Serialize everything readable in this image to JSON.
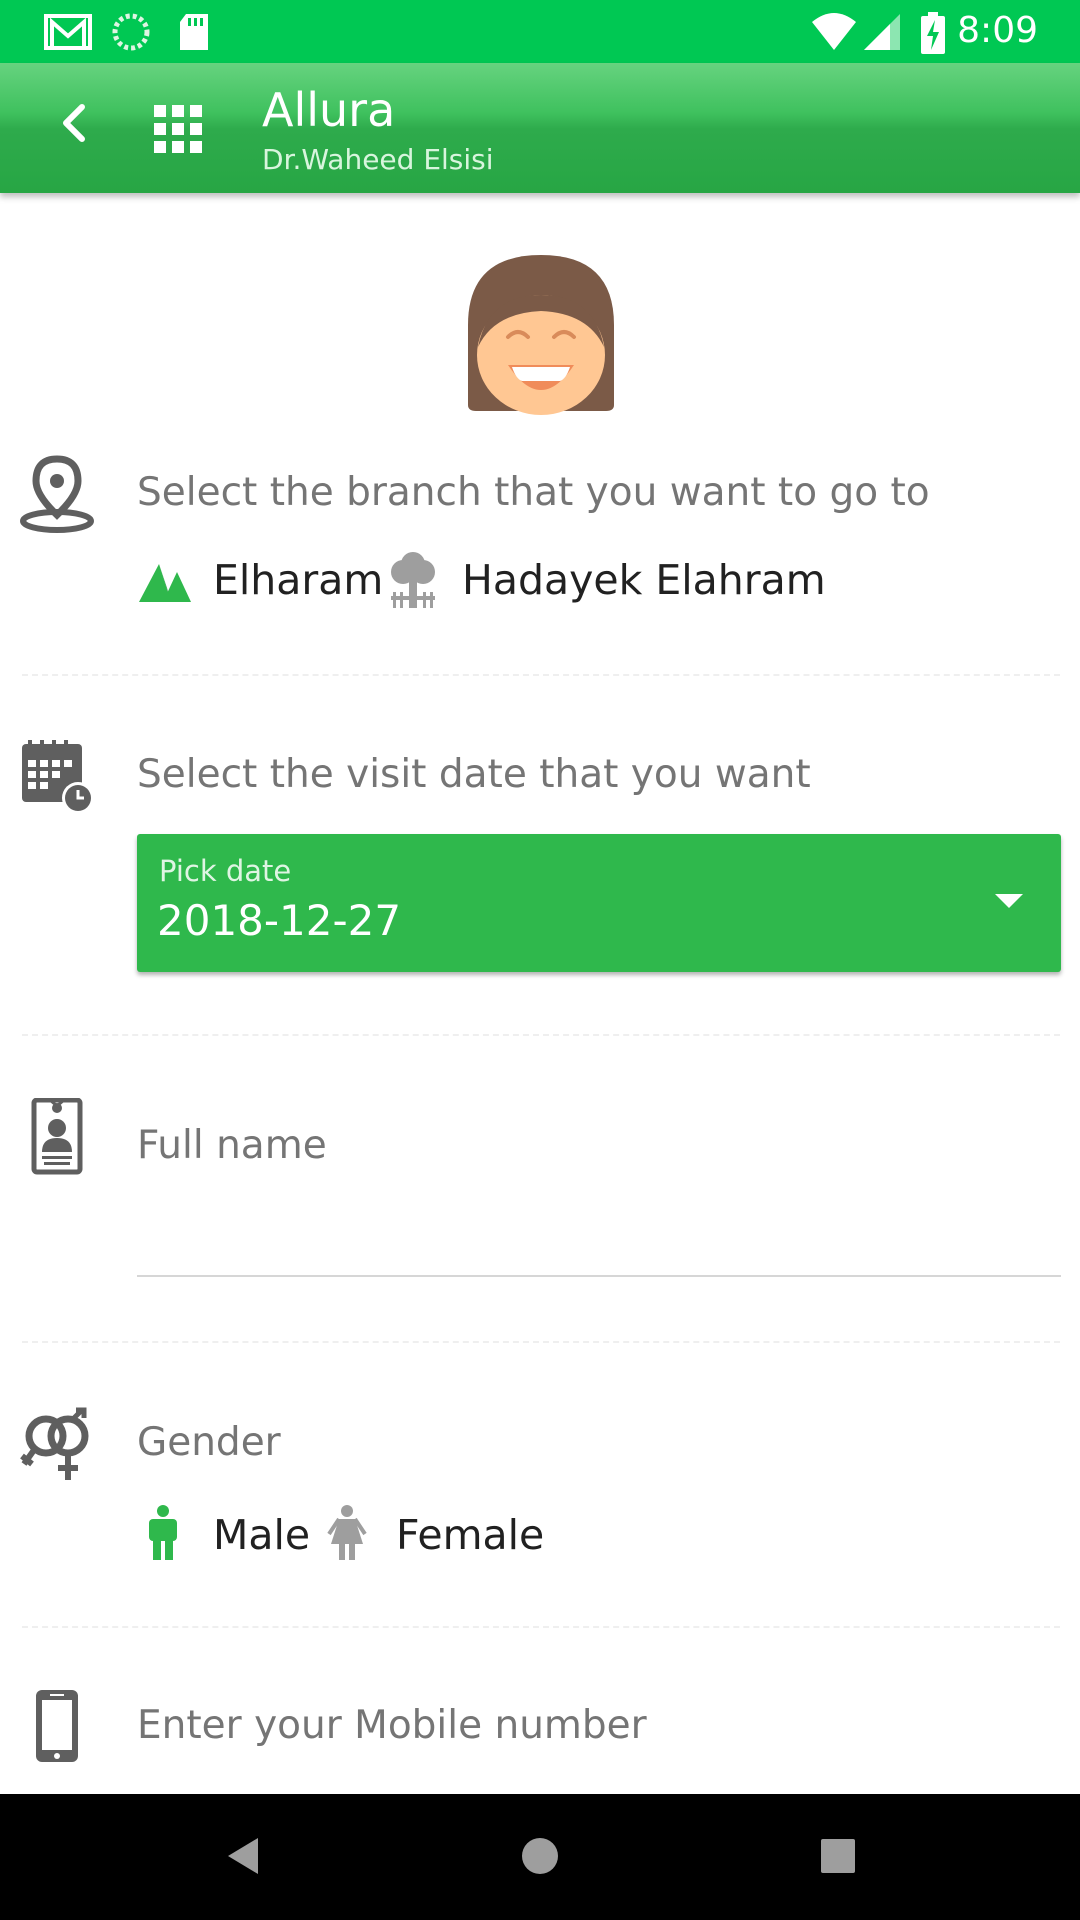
{
  "status_bar": {
    "time": "8:09",
    "left_icons": [
      "gmail-icon",
      "sync-icon",
      "sd-card-icon"
    ],
    "right_icons": [
      "wifi-icon",
      "cell-signal-icon",
      "battery-charging-icon"
    ]
  },
  "app_bar": {
    "title": "Allura",
    "subtitle": "Dr.Waheed Elsisi",
    "back_icon": "back-arrow-icon",
    "apps_icon": "apps-grid-icon"
  },
  "colors": {
    "status_bar": "#00c853",
    "app_bar": "#2eab4c",
    "accent": "#2fb84c",
    "inactive_icon": "#9e9e9e"
  },
  "branch": {
    "icon": "location-pin-icon",
    "label": "Select the branch that you want to go to",
    "options": [
      {
        "label": "Elharam",
        "icon": "pyramids-icon",
        "selected": true
      },
      {
        "label": "Hadayek Elahram",
        "icon": "tree-icon",
        "selected": false
      }
    ]
  },
  "visit_date": {
    "icon": "calendar-clock-icon",
    "label": "Select the visit date that you want",
    "picker_label": "Pick date",
    "value": "2018-12-27"
  },
  "full_name": {
    "icon": "id-badge-icon",
    "placeholder": "Full name",
    "value": ""
  },
  "gender": {
    "icon": "gender-icon",
    "label": "Gender",
    "options": [
      {
        "label": "Male",
        "icon": "male-icon",
        "selected": true
      },
      {
        "label": "Female",
        "icon": "female-icon",
        "selected": false
      }
    ]
  },
  "mobile": {
    "icon": "mobile-phone-icon",
    "placeholder": "Enter your Mobile number",
    "value": ""
  },
  "nav_bar": {
    "buttons": [
      "nav-back-icon",
      "nav-home-icon",
      "nav-recents-icon"
    ]
  }
}
